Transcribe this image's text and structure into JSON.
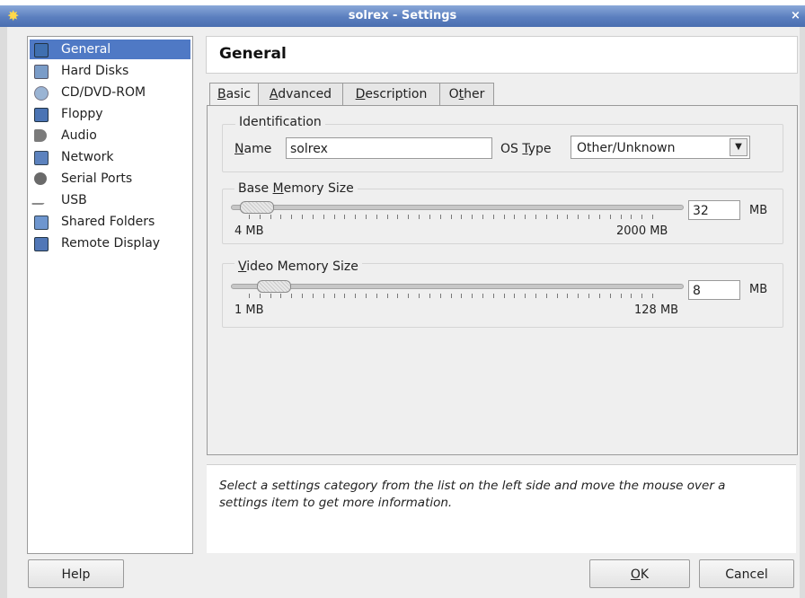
{
  "window": {
    "title": "solrex - Settings",
    "close_glyph": "×"
  },
  "sidebar": {
    "items": [
      {
        "label": "General",
        "icon": "monitor-icon",
        "color": "#3f6fb0"
      },
      {
        "label": "Hard Disks",
        "icon": "harddisk-icon",
        "color": "#7a9cc8"
      },
      {
        "label": "CD/DVD-ROM",
        "icon": "cd-icon",
        "color": "#9ab4d4"
      },
      {
        "label": "Floppy",
        "icon": "floppy-icon",
        "color": "#4b74b4"
      },
      {
        "label": "Audio",
        "icon": "speaker-icon",
        "color": "#7b7b7b"
      },
      {
        "label": "Network",
        "icon": "network-icon",
        "color": "#5c82be"
      },
      {
        "label": "Serial Ports",
        "icon": "serial-port-icon",
        "color": "#6a6a6a"
      },
      {
        "label": "USB",
        "icon": "usb-icon",
        "color": "#8c8c8c"
      },
      {
        "label": "Shared Folders",
        "icon": "folder-icon",
        "color": "#6e96cf"
      },
      {
        "label": "Remote Display",
        "icon": "remote-display-icon",
        "color": "#5177b7"
      }
    ],
    "selected_index": 0
  },
  "content": {
    "heading": "General"
  },
  "tabs": [
    {
      "label": "Basic",
      "ul": "B",
      "rest": "asic"
    },
    {
      "label": "Advanced",
      "ul": "A",
      "rest": "dvanced"
    },
    {
      "label": "Description",
      "ul": "D",
      "rest": "escription"
    },
    {
      "label": "Other",
      "pre": "O",
      "ul": "t",
      "rest": "her"
    }
  ],
  "identification": {
    "group_title": "Identification",
    "name_label_ul": "N",
    "name_label_rest": "ame",
    "name_value": "solrex",
    "os_label_pre": "OS ",
    "os_label_ul": "T",
    "os_label_rest": "ype",
    "os_value": "Other/Unknown"
  },
  "base_memory": {
    "title_pre": "Base ",
    "title_ul": "M",
    "title_rest": "emory Size",
    "min_label": "4 MB",
    "max_label": "2000 MB",
    "value": "32",
    "unit": "MB",
    "level_fraction": 0.014
  },
  "video_memory": {
    "title_ul": "V",
    "title_rest": "ideo Memory Size",
    "min_label": "1 MB",
    "max_label": "128 MB",
    "value": "8",
    "unit": "MB",
    "level_fraction": 0.055
  },
  "info": {
    "text": "Select a settings category from the list on the left side and move the mouse over a settings item to get more information."
  },
  "buttons": {
    "help": "Help",
    "ok_ul": "O",
    "ok_rest": "K",
    "cancel": "Cancel"
  }
}
